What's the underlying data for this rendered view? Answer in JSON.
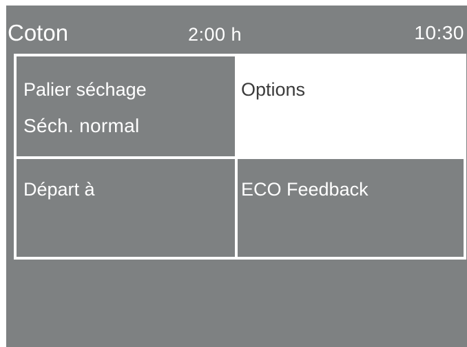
{
  "status_bar": {
    "program": "Coton",
    "duration": "2:00 h",
    "clock": "10:30"
  },
  "menu": {
    "tiles": [
      {
        "label": "Palier séchage",
        "value": "Séch. normal",
        "selected": false
      },
      {
        "label": "Options",
        "value": "",
        "selected": true
      },
      {
        "label": "Départ à",
        "value": "",
        "selected": false
      },
      {
        "label": "ECO Feedback",
        "value": "",
        "selected": false
      }
    ]
  },
  "colors": {
    "background": "#7e8182",
    "text": "#ffffff",
    "selected_background": "#ffffff",
    "selected_text": "#3a3a3a"
  }
}
